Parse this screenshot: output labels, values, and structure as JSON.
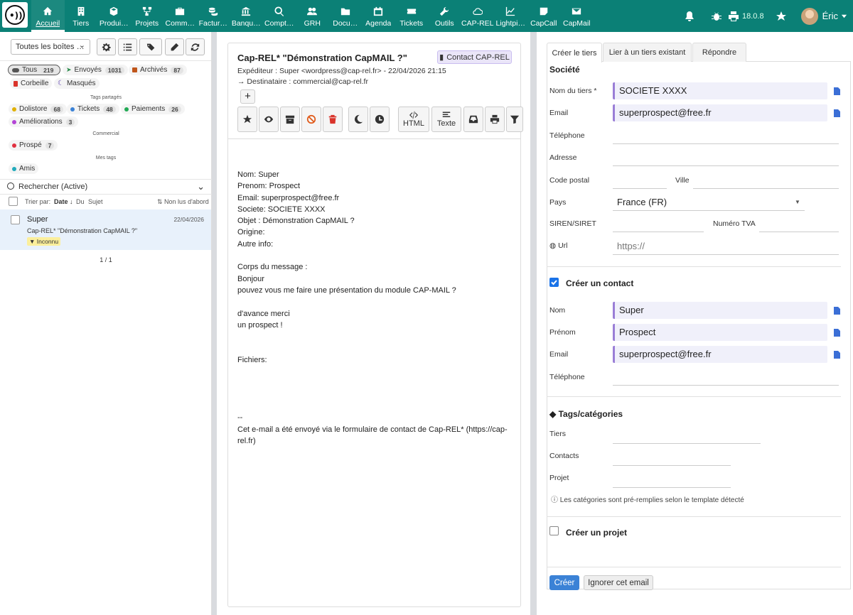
{
  "nav": [
    {
      "label": "Accueil",
      "icon": "home-icon"
    },
    {
      "label": "Tiers",
      "icon": "building-icon"
    },
    {
      "label": "Produi…",
      "icon": "cube-icon"
    },
    {
      "label": "Projets",
      "icon": "sitemap-icon"
    },
    {
      "label": "Comm…",
      "icon": "briefcase-icon"
    },
    {
      "label": "Factur…",
      "icon": "coins-icon"
    },
    {
      "label": "Banqu…",
      "icon": "bank-icon"
    },
    {
      "label": "Compt…",
      "icon": "search-dollar-icon"
    },
    {
      "label": "GRH",
      "icon": "users-icon"
    },
    {
      "label": "Docu…",
      "icon": "folder-icon"
    },
    {
      "label": "Agenda",
      "icon": "calendar-icon"
    },
    {
      "label": "Tickets",
      "icon": "ticket-icon"
    },
    {
      "label": "Outils",
      "icon": "wrench-icon"
    },
    {
      "label": "CAP-REL",
      "icon": "cloud-icon"
    },
    {
      "label": "Lightpi…",
      "icon": "chart-line-icon"
    },
    {
      "label": "CapCall",
      "icon": "sticky-note-icon"
    },
    {
      "label": "CapMail",
      "icon": "envelope-icon"
    }
  ],
  "topright": {
    "version": "18.0.8",
    "user": "Éric"
  },
  "left": {
    "mailbox_select": "Toutes les boîtes …",
    "folders": [
      {
        "label": "Tous",
        "count": "219",
        "color": "#555555"
      },
      {
        "label": "Envoyés",
        "count": "1031",
        "color": "#2a8a4a"
      },
      {
        "label": "Archivés",
        "count": "87",
        "color": "#c0561b"
      },
      {
        "label": "Corbeille",
        "count": "",
        "color": "#d9342b"
      },
      {
        "label": "Masqués",
        "count": "",
        "color": "#5b3fb0"
      }
    ],
    "section_shared": "Tags partagés",
    "shared_tags": [
      {
        "label": "Dolistore",
        "count": "68",
        "color": "#e0b000"
      },
      {
        "label": "Tickets",
        "count": "48",
        "color": "#3b82d6"
      },
      {
        "label": "Paiements",
        "count": "26",
        "color": "#22aa55"
      },
      {
        "label": "Améliorations",
        "count": "3",
        "color": "#b344d6"
      }
    ],
    "section_commercial": "Commercial",
    "commercial_tags": [
      {
        "label": "Prospé",
        "count": "7",
        "color": "#e03040"
      }
    ],
    "section_mine": "Mes tags",
    "my_tags": [
      {
        "label": "Amis",
        "count": "",
        "color": "#22aabb"
      }
    ],
    "search_label": "Rechercher (Active)",
    "sort": {
      "prefix": "Trier par:",
      "date": "Date ↓",
      "from": "Du",
      "subject": "Sujet",
      "unread": "Non lus d'abord"
    },
    "message": {
      "sender": "Super",
      "date": "22/04/2026",
      "subject": "Cap-REL* \"Démonstration CapMAIL ?\"",
      "badge": "Inconnu"
    },
    "pager": "1 / 1"
  },
  "mid": {
    "subject": "Cap-REL* \"Démonstration CapMAIL ?\"",
    "contact_badge": "Contact CAP-REL",
    "from": "Expéditeur : Super <wordpress@cap-rel.fr> - 22/04/2026 21:15",
    "to": "Destinataire : commercial@cap-rel.fr",
    "html_label": "HTML",
    "text_label": "Texte",
    "body": "Nom: Super\nPrenom: Prospect\nEmail: superprospect@free.fr\nSociete: SOCIETE XXXX\nObjet : Démonstration CapMAIL ?\nOrigine:\nAutre info:\n\nCorps du message :\nBonjour\npouvez vous me faire une présentation du module CAP-MAIL ?\n\nd'avance merci\nun prospect !\n\n\nFichiers:\n\n\n\n\n--\nCet e-mail a été envoyé via le formulaire de contact de Cap-REL* (https://cap-rel.fr)"
  },
  "right": {
    "tabs": [
      "Créer le tiers",
      "Lier à un tiers existant",
      "Répondre"
    ],
    "company_header": "Société",
    "company": {
      "name_label": "Nom du tiers *",
      "name": "SOCIETE XXXX",
      "email_label": "Email",
      "email": "superprospect@free.fr",
      "phone_label": "Téléphone",
      "address_label": "Adresse",
      "zip_label": "Code postal",
      "city_label": "Ville",
      "country_label": "Pays",
      "country": "France (FR)",
      "siren_label": "SIREN/SIRET",
      "vat_label": "Numéro TVA",
      "url_label": "Url",
      "url_placeholder": "https://"
    },
    "contact_header": "Créer un contact",
    "contact": {
      "lastname_label": "Nom",
      "lastname": "Super",
      "firstname_label": "Prénom",
      "firstname": "Prospect",
      "email_label": "Email",
      "email": "superprospect@free.fr",
      "phone_label": "Téléphone"
    },
    "tags_header": "Tags/catégories",
    "tags": {
      "tiers_label": "Tiers",
      "contacts_label": "Contacts",
      "projet_label": "Projet",
      "note": "Les catégories sont pré-remplies selon le template détecté"
    },
    "project_header": "Créer un projet",
    "create_button": "Créer",
    "ignore_button": "Ignorer cet email"
  },
  "colors": {
    "topbar": "#0b8076",
    "primary": "#3b82d6",
    "filled_field": "#f0f0fa",
    "field_accent": "#9a7ed6"
  }
}
